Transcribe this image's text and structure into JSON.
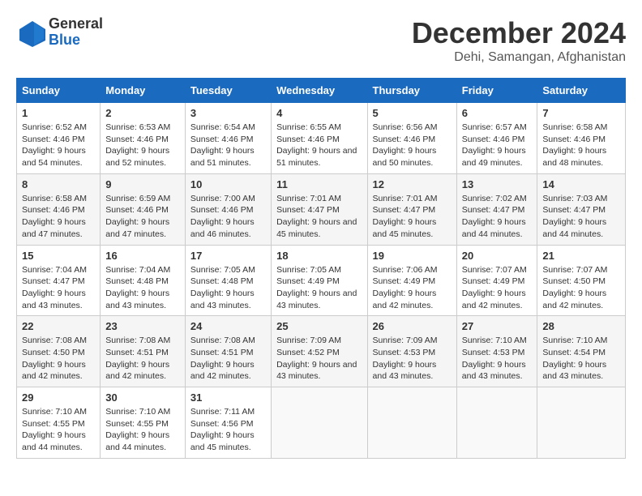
{
  "header": {
    "logo_general": "General",
    "logo_blue": "Blue",
    "title": "December 2024",
    "location": "Dehi, Samangan, Afghanistan"
  },
  "weekdays": [
    "Sunday",
    "Monday",
    "Tuesday",
    "Wednesday",
    "Thursday",
    "Friday",
    "Saturday"
  ],
  "weeks": [
    [
      {
        "day": "1",
        "sunrise": "6:52 AM",
        "sunset": "4:46 PM",
        "daylight": "9 hours and 54 minutes."
      },
      {
        "day": "2",
        "sunrise": "6:53 AM",
        "sunset": "4:46 PM",
        "daylight": "9 hours and 52 minutes."
      },
      {
        "day": "3",
        "sunrise": "6:54 AM",
        "sunset": "4:46 PM",
        "daylight": "9 hours and 51 minutes."
      },
      {
        "day": "4",
        "sunrise": "6:55 AM",
        "sunset": "4:46 PM",
        "daylight": "9 hours and 51 minutes."
      },
      {
        "day": "5",
        "sunrise": "6:56 AM",
        "sunset": "4:46 PM",
        "daylight": "9 hours and 50 minutes."
      },
      {
        "day": "6",
        "sunrise": "6:57 AM",
        "sunset": "4:46 PM",
        "daylight": "9 hours and 49 minutes."
      },
      {
        "day": "7",
        "sunrise": "6:58 AM",
        "sunset": "4:46 PM",
        "daylight": "9 hours and 48 minutes."
      }
    ],
    [
      {
        "day": "8",
        "sunrise": "6:58 AM",
        "sunset": "4:46 PM",
        "daylight": "9 hours and 47 minutes."
      },
      {
        "day": "9",
        "sunrise": "6:59 AM",
        "sunset": "4:46 PM",
        "daylight": "9 hours and 47 minutes."
      },
      {
        "day": "10",
        "sunrise": "7:00 AM",
        "sunset": "4:46 PM",
        "daylight": "9 hours and 46 minutes."
      },
      {
        "day": "11",
        "sunrise": "7:01 AM",
        "sunset": "4:47 PM",
        "daylight": "9 hours and 45 minutes."
      },
      {
        "day": "12",
        "sunrise": "7:01 AM",
        "sunset": "4:47 PM",
        "daylight": "9 hours and 45 minutes."
      },
      {
        "day": "13",
        "sunrise": "7:02 AM",
        "sunset": "4:47 PM",
        "daylight": "9 hours and 44 minutes."
      },
      {
        "day": "14",
        "sunrise": "7:03 AM",
        "sunset": "4:47 PM",
        "daylight": "9 hours and 44 minutes."
      }
    ],
    [
      {
        "day": "15",
        "sunrise": "7:04 AM",
        "sunset": "4:47 PM",
        "daylight": "9 hours and 43 minutes."
      },
      {
        "day": "16",
        "sunrise": "7:04 AM",
        "sunset": "4:48 PM",
        "daylight": "9 hours and 43 minutes."
      },
      {
        "day": "17",
        "sunrise": "7:05 AM",
        "sunset": "4:48 PM",
        "daylight": "9 hours and 43 minutes."
      },
      {
        "day": "18",
        "sunrise": "7:05 AM",
        "sunset": "4:49 PM",
        "daylight": "9 hours and 43 minutes."
      },
      {
        "day": "19",
        "sunrise": "7:06 AM",
        "sunset": "4:49 PM",
        "daylight": "9 hours and 42 minutes."
      },
      {
        "day": "20",
        "sunrise": "7:07 AM",
        "sunset": "4:49 PM",
        "daylight": "9 hours and 42 minutes."
      },
      {
        "day": "21",
        "sunrise": "7:07 AM",
        "sunset": "4:50 PM",
        "daylight": "9 hours and 42 minutes."
      }
    ],
    [
      {
        "day": "22",
        "sunrise": "7:08 AM",
        "sunset": "4:50 PM",
        "daylight": "9 hours and 42 minutes."
      },
      {
        "day": "23",
        "sunrise": "7:08 AM",
        "sunset": "4:51 PM",
        "daylight": "9 hours and 42 minutes."
      },
      {
        "day": "24",
        "sunrise": "7:08 AM",
        "sunset": "4:51 PM",
        "daylight": "9 hours and 42 minutes."
      },
      {
        "day": "25",
        "sunrise": "7:09 AM",
        "sunset": "4:52 PM",
        "daylight": "9 hours and 43 minutes."
      },
      {
        "day": "26",
        "sunrise": "7:09 AM",
        "sunset": "4:53 PM",
        "daylight": "9 hours and 43 minutes."
      },
      {
        "day": "27",
        "sunrise": "7:10 AM",
        "sunset": "4:53 PM",
        "daylight": "9 hours and 43 minutes."
      },
      {
        "day": "28",
        "sunrise": "7:10 AM",
        "sunset": "4:54 PM",
        "daylight": "9 hours and 43 minutes."
      }
    ],
    [
      {
        "day": "29",
        "sunrise": "7:10 AM",
        "sunset": "4:55 PM",
        "daylight": "9 hours and 44 minutes."
      },
      {
        "day": "30",
        "sunrise": "7:10 AM",
        "sunset": "4:55 PM",
        "daylight": "9 hours and 44 minutes."
      },
      {
        "day": "31",
        "sunrise": "7:11 AM",
        "sunset": "4:56 PM",
        "daylight": "9 hours and 45 minutes."
      },
      null,
      null,
      null,
      null
    ]
  ],
  "labels": {
    "sunrise": "Sunrise:",
    "sunset": "Sunset:",
    "daylight": "Daylight:"
  }
}
